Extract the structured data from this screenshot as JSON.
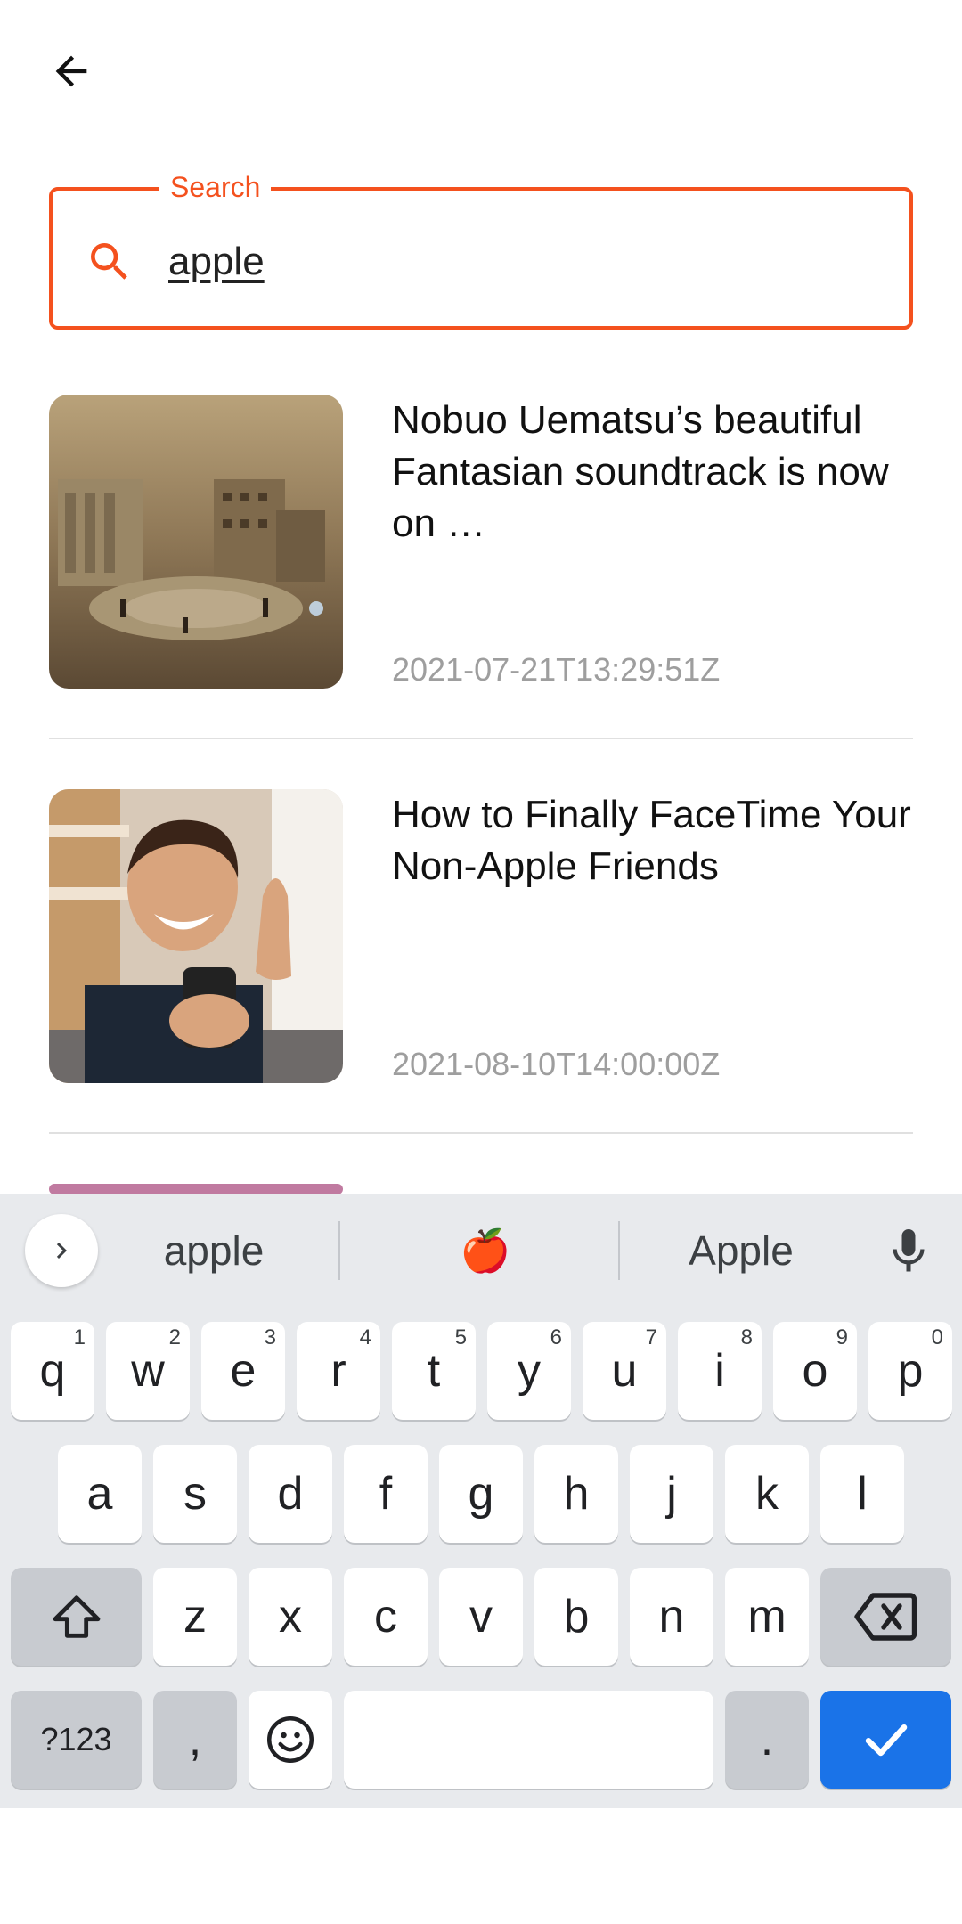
{
  "search": {
    "label": "Search",
    "value": "apple"
  },
  "results": [
    {
      "title": "Nobuo Uematsu’s beautiful Fantasian soundtrack is now on …",
      "date": "2021-07-21T13:29:51Z"
    },
    {
      "title": "How to Finally FaceTime Your Non-Apple Friends",
      "date": "2021-08-10T14:00:00Z"
    }
  ],
  "keyboard": {
    "suggestions": [
      "apple",
      "🍎",
      "Apple"
    ],
    "row1": [
      {
        "key": "q",
        "hint": "1"
      },
      {
        "key": "w",
        "hint": "2"
      },
      {
        "key": "e",
        "hint": "3"
      },
      {
        "key": "r",
        "hint": "4"
      },
      {
        "key": "t",
        "hint": "5"
      },
      {
        "key": "y",
        "hint": "6"
      },
      {
        "key": "u",
        "hint": "7"
      },
      {
        "key": "i",
        "hint": "8"
      },
      {
        "key": "o",
        "hint": "9"
      },
      {
        "key": "p",
        "hint": "0"
      }
    ],
    "row2": [
      "a",
      "s",
      "d",
      "f",
      "g",
      "h",
      "j",
      "k",
      "l"
    ],
    "row3": [
      "z",
      "x",
      "c",
      "v",
      "b",
      "n",
      "m"
    ],
    "symbols_label": "?123",
    "comma": ",",
    "period": "."
  },
  "colors": {
    "accent": "#f4511e",
    "enter": "#1a73e8"
  }
}
